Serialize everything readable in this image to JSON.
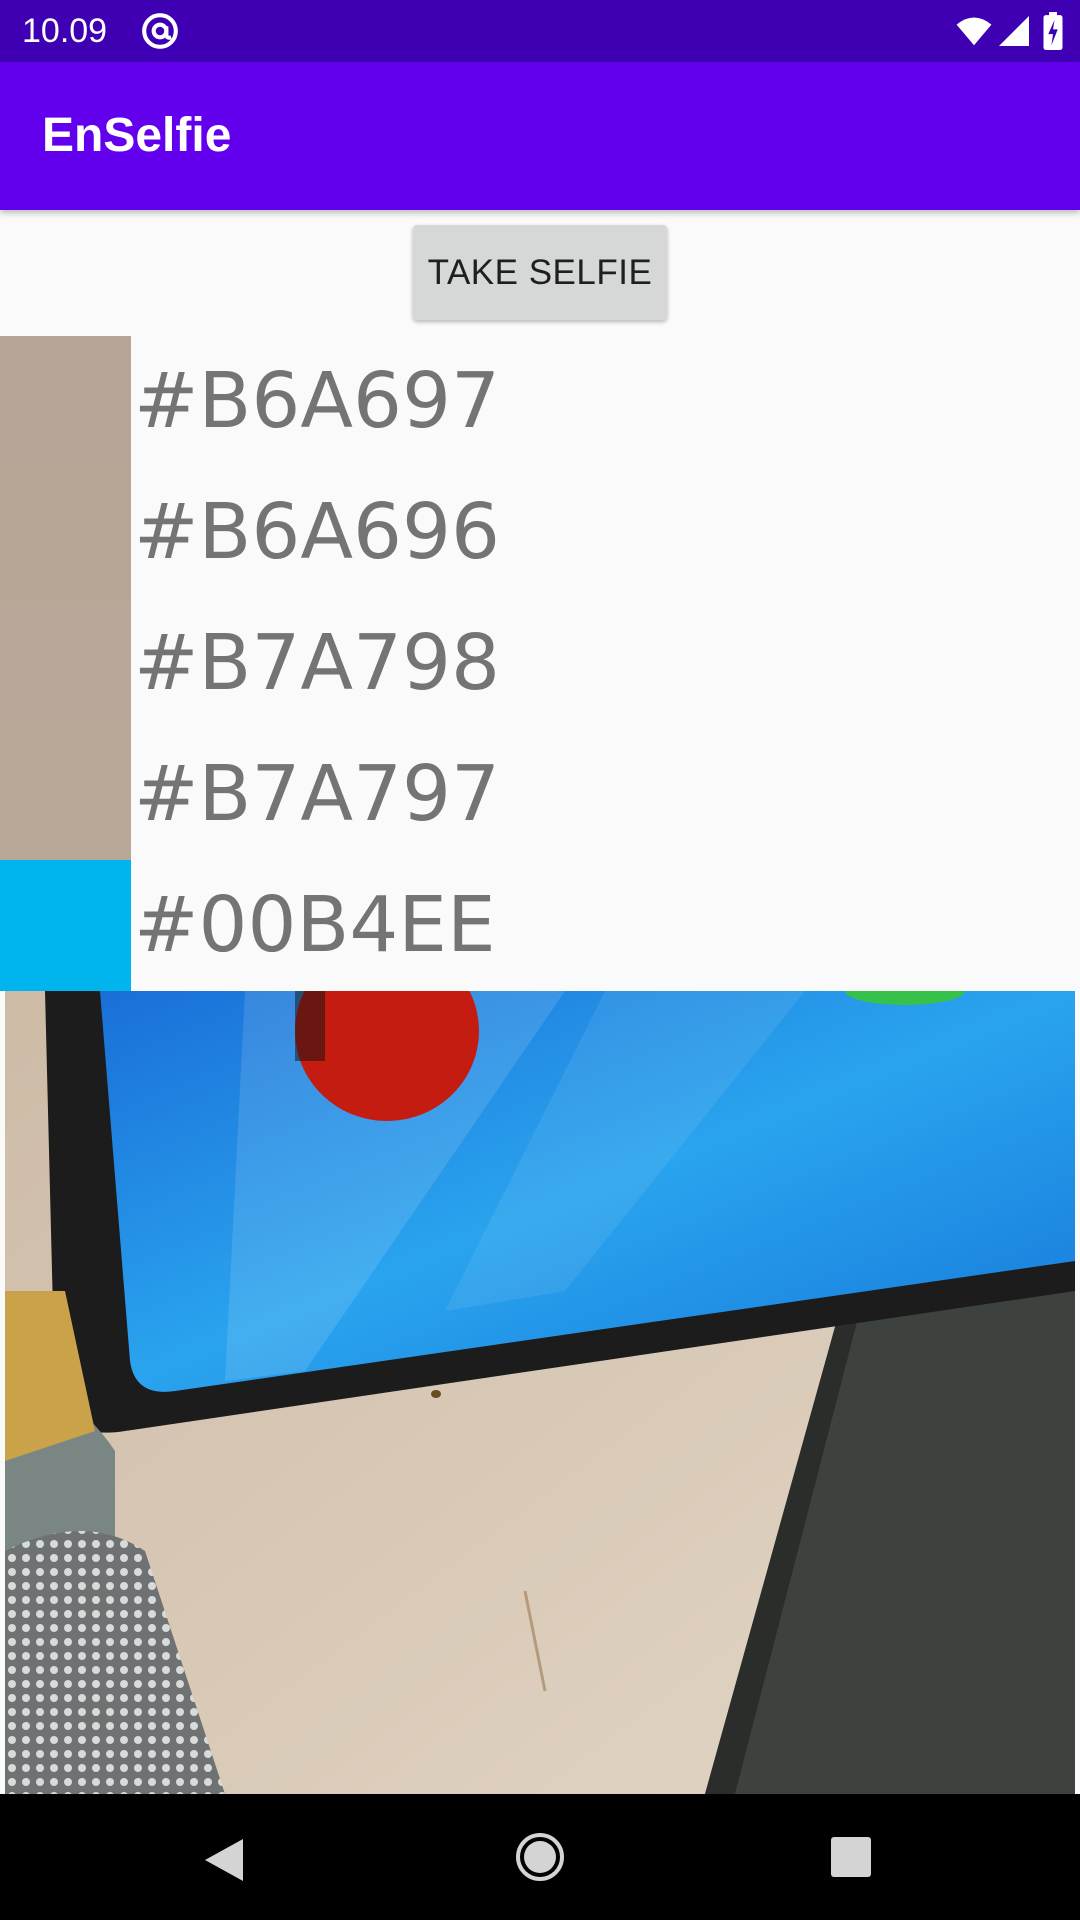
{
  "status_bar": {
    "time": "10.09",
    "icons": [
      "at-sign-icon",
      "wifi-icon",
      "signal-icon",
      "battery-charging-icon"
    ]
  },
  "app_bar": {
    "title": "EnSelfie"
  },
  "actions": {
    "take_selfie_label": "TAKE SELFIE"
  },
  "colors": [
    {
      "hex": "#B6A697",
      "swatch": "#B6A697"
    },
    {
      "hex": "#B6A696",
      "swatch": "#B6A696"
    },
    {
      "hex": "#B7A798",
      "swatch": "#B7A798"
    },
    {
      "hex": "#B7A797",
      "swatch": "#B7A797"
    },
    {
      "hex": "#00B4EE",
      "swatch": "#00B4EE"
    }
  ],
  "photo": {
    "description_icon": "selfie-photo",
    "colors": {
      "screen": "#1a8fe0",
      "table": "#d8c9b6",
      "mat": "#3a3d3a",
      "phone_body": "#1e1e1e",
      "alarm": "#c41c10"
    }
  },
  "nav_bar": {
    "icons": [
      "back-icon",
      "home-icon",
      "recents-icon"
    ]
  },
  "theme": {
    "status_bar": "#3f00b3",
    "primary": "#6200ee",
    "background": "#fafafa"
  }
}
